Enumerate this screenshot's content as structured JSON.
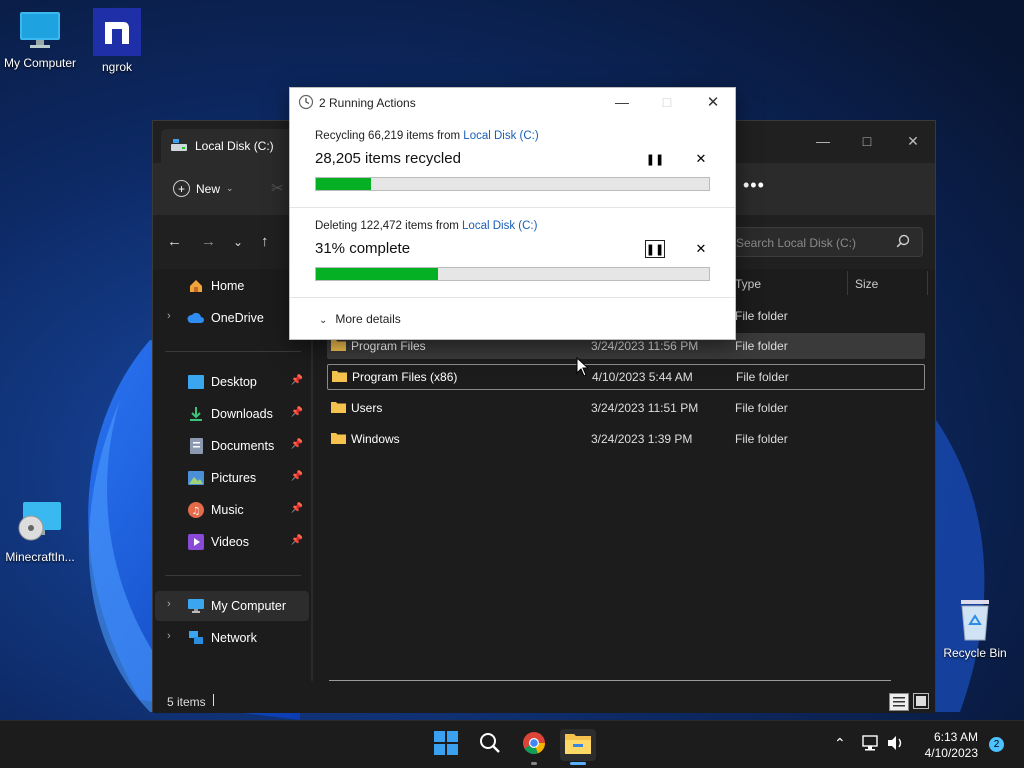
{
  "desktop": {
    "icons": [
      {
        "label": "My Computer"
      },
      {
        "label": "ngrok"
      },
      {
        "label": "MinecraftIn..."
      },
      {
        "label": "Recycle Bin"
      }
    ]
  },
  "explorer": {
    "tab_title": "Local Disk (C:)",
    "toolbar": {
      "new_label": "New"
    },
    "search_placeholder": "Search Local Disk (C:)",
    "columns": {
      "type": "Type",
      "size": "Size"
    },
    "sidebar": {
      "home": "Home",
      "onedrive": "OneDrive",
      "desktop": "Desktop",
      "downloads": "Downloads",
      "documents": "Documents",
      "pictures": "Pictures",
      "music": "Music",
      "videos": "Videos",
      "my_computer": "My Computer",
      "network": "Network"
    },
    "rows": [
      {
        "name": "",
        "date": "",
        "type": "File folder"
      },
      {
        "name": "Program Files",
        "date": "3/24/2023 11:56 PM",
        "type": "File folder"
      },
      {
        "name": "Program Files (x86)",
        "date": "4/10/2023 5:44 AM",
        "type": "File folder"
      },
      {
        "name": "Users",
        "date": "3/24/2023 11:51 PM",
        "type": "File folder"
      },
      {
        "name": "Windows",
        "date": "3/24/2023 1:39 PM",
        "type": "File folder"
      }
    ],
    "status": "5 items"
  },
  "dialog": {
    "title": "2 Running Actions",
    "op1": {
      "prefix": "Recycling 66,219 items from ",
      "link": "Local Disk (C:)",
      "progress_text": "28,205 items recycled",
      "progress": 0.14
    },
    "op2": {
      "prefix": "Deleting 122,472 items from ",
      "link": "Local Disk (C:)",
      "progress_text": "31% complete",
      "progress": 0.31
    },
    "more_details": "More details"
  },
  "taskbar": {
    "time": "6:13 AM",
    "date": "4/10/2023",
    "notification_count": "2"
  }
}
